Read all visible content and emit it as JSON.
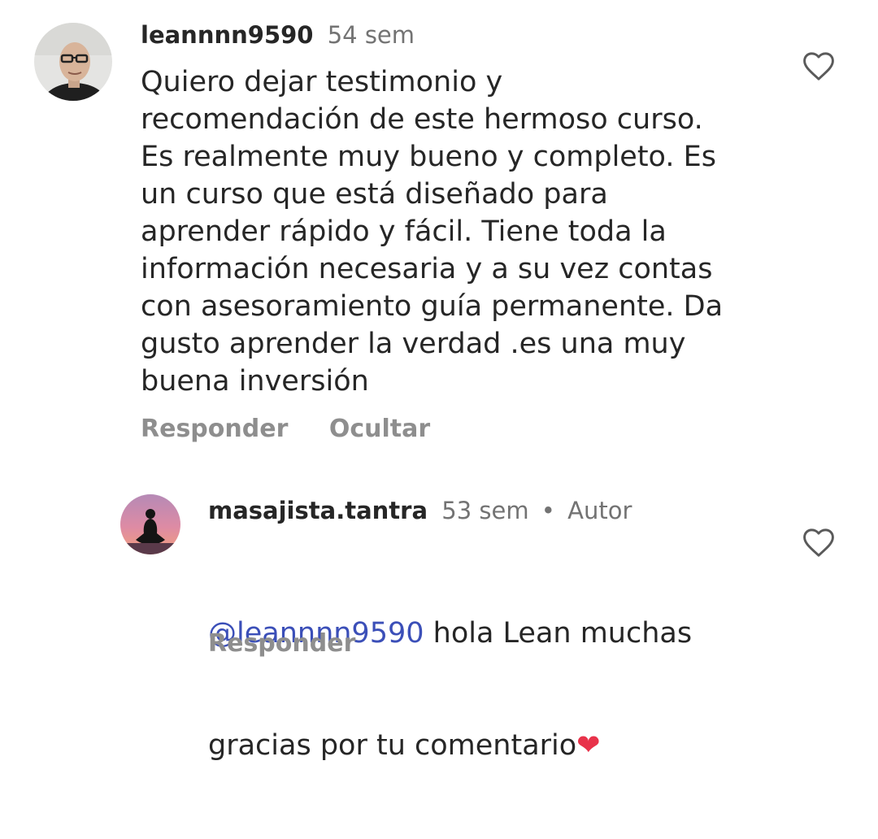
{
  "comments": [
    {
      "username": "leannnn9590",
      "time": "54 sem",
      "text": "Quiero dejar testimonio y\nrecomendación de este hermoso curso.\nEs realmente muy bueno y completo. Es\nun curso que está diseñado para\naprender rápido y fácil. Tiene toda la\ninformación necesaria y a su vez contas\ncon asesoramiento guía permanente. Da\ngusto aprender la verdad .es una muy\nbuena inversión",
      "reply_label": "Responder",
      "hide_label": "Ocultar",
      "like_icon": "heart-outline-icon"
    }
  ],
  "replies": [
    {
      "username": "masajista.tantra",
      "time": "53 sem",
      "separator": "•",
      "author_tag": "Autor",
      "mention_symbol": "@",
      "mention": "leannnn9590",
      "text_line1": " hola Lean muchas",
      "text_line2": "gracias por tu comentario",
      "emoji": "❤",
      "reply_label": "Responder",
      "like_icon": "heart-outline-icon"
    }
  ],
  "colors": {
    "mention": "#3b4fb8",
    "secondary_text": "#737373",
    "action_text": "#8e8e8e",
    "heart_emoji": "#e8324a"
  }
}
